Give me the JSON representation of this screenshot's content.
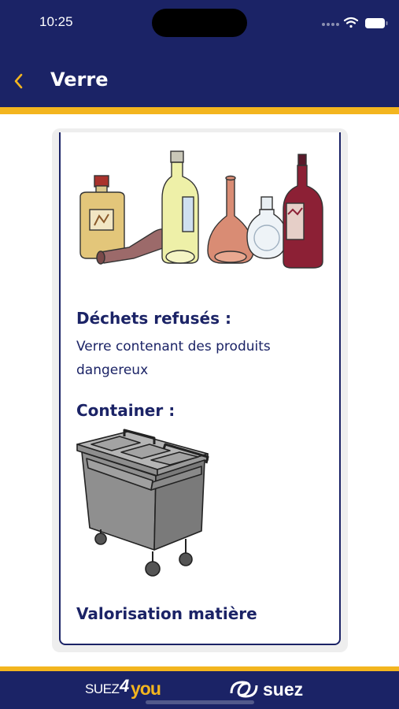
{
  "status_bar": {
    "time": "10:25",
    "icons": [
      "signal-dots-icon",
      "wifi-icon",
      "battery-icon"
    ]
  },
  "nav": {
    "title": "Verre",
    "back_icon": "chevron-left-icon"
  },
  "card": {
    "image": "glass-bottles-illustration",
    "refused_title": "Déchets refusés :",
    "refused_text": "Verre contenant des produits dangereux",
    "container_title": "Container :",
    "container_image": "waste-bin-illustration",
    "valorisation_title": "Valorisation matière"
  },
  "footer": {
    "logo_left_prefix": "SUEZ",
    "logo_left_number": "4",
    "logo_left_suffix": "you",
    "logo_right": "suez"
  },
  "colors": {
    "navy": "#1b2366",
    "yellow": "#f3b51f",
    "card_bg": "#eeeeee"
  }
}
